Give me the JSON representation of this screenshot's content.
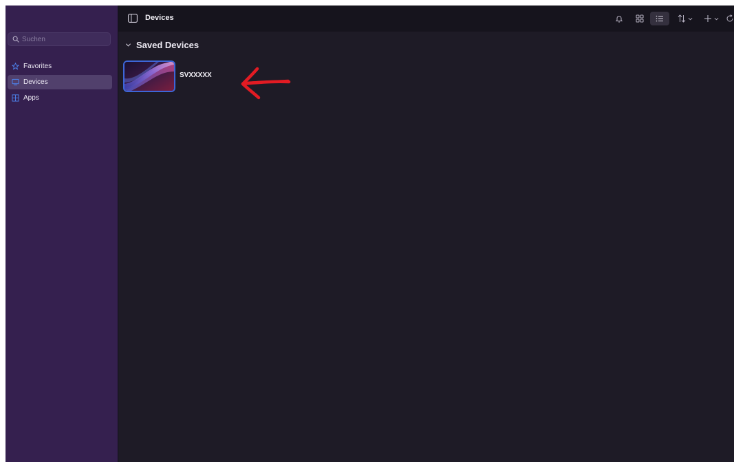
{
  "search": {
    "placeholder": "Suchen",
    "value": ""
  },
  "sidebar": {
    "items": [
      {
        "label": "Favorites",
        "icon": "star-icon",
        "active": false
      },
      {
        "label": "Devices",
        "icon": "monitor-icon",
        "active": true
      },
      {
        "label": "Apps",
        "icon": "grid-icon",
        "active": false
      }
    ]
  },
  "toolbar": {
    "title": "Devices",
    "view_mode": "list"
  },
  "main": {
    "section_title": "Saved Devices",
    "devices": [
      {
        "name": "SVXXXXX",
        "selected": true
      }
    ]
  },
  "colors": {
    "sidebar_bg": "#35204f",
    "main_bg": "#1e1b26",
    "accent_blue": "#3d66d8",
    "annotation_red": "#e21b23"
  }
}
